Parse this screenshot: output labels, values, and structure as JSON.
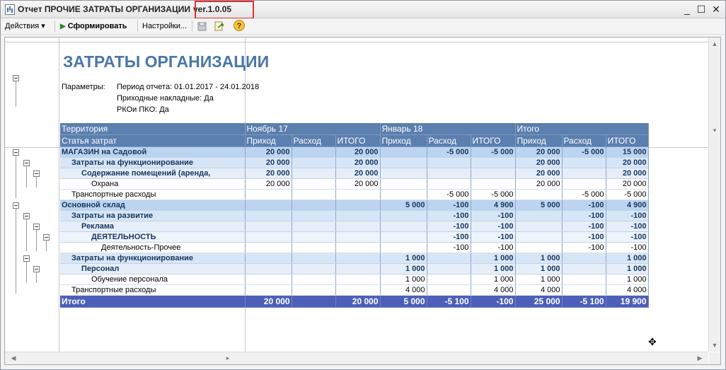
{
  "window": {
    "title_prefix": "Отчет  ПРОЧИЕ ЗАТРАТЫ ОРГАНИЗАЦИИ",
    "version": "ver.1.0.05",
    "minimize": "_",
    "maximize": "☐",
    "close": "✕"
  },
  "toolbar": {
    "actions_label": "Действия ▾",
    "generate_label": "Сформировать",
    "settings_label": "Настройки...",
    "help_label": "?"
  },
  "icons": {
    "app": "report-icon",
    "play": "play-icon",
    "save": "save-icon",
    "export": "export-icon",
    "help": "help-icon"
  },
  "colors": {
    "title": "#4a77a8",
    "header": "#5b7fae",
    "total": "#4d5fb8",
    "highlight": "#e03030"
  },
  "report": {
    "title": "ЗАТРАТЫ ОРГАНИЗАЦИИ",
    "params_label": "Параметры:",
    "params": [
      "Период отчета: 01.01.2017 - 24.01.2018",
      "Приходные накладные: Да",
      "РКОи ПКО: Да"
    ],
    "header_top": {
      "territory": "Территория",
      "nov": "Ноябрь 17",
      "jan": "Январь 18",
      "total": "Итого"
    },
    "header_bottom": {
      "article": "Статья затрат",
      "cols": [
        "Приход",
        "Расход",
        "ИТОГО",
        "Приход",
        "Расход",
        "ИТОГО",
        "Приход",
        "Расход",
        "ИТОГО"
      ]
    },
    "rows": [
      {
        "label": "МАГАЗИН на Садовой",
        "cls": "l0",
        "indent": 0,
        "v": [
          "20 000",
          "",
          "20 000",
          "",
          "-5 000",
          "-5 000",
          "20 000",
          "-5 000",
          "15 000"
        ]
      },
      {
        "label": "Затраты на функционирование",
        "cls": "l1",
        "indent": 1,
        "v": [
          "20 000",
          "",
          "20 000",
          "",
          "",
          "",
          "20 000",
          "",
          "20 000"
        ]
      },
      {
        "label": "Содержание помещений (аренда,",
        "cls": "l2",
        "indent": 2,
        "v": [
          "20 000",
          "",
          "20 000",
          "",
          "",
          "",
          "20 000",
          "",
          "20 000"
        ]
      },
      {
        "label": "Охрана",
        "cls": "leaf",
        "indent": 3,
        "v": [
          "20 000",
          "",
          "20 000",
          "",
          "",
          "",
          "20 000",
          "",
          "20 000"
        ]
      },
      {
        "label": "Транспортные расходы",
        "cls": "leaf",
        "indent": 1,
        "v": [
          "",
          "",
          "",
          "",
          "-5 000",
          "-5 000",
          "",
          "-5 000",
          "-5 000"
        ]
      },
      {
        "label": "Основной склад",
        "cls": "l0",
        "indent": 0,
        "v": [
          "",
          "",
          "",
          "5 000",
          "-100",
          "4 900",
          "5 000",
          "-100",
          "4 900"
        ]
      },
      {
        "label": "Затраты на развитие",
        "cls": "l1",
        "indent": 1,
        "v": [
          "",
          "",
          "",
          "",
          "-100",
          "-100",
          "",
          "-100",
          "-100"
        ]
      },
      {
        "label": "Реклама",
        "cls": "l2",
        "indent": 2,
        "v": [
          "",
          "",
          "",
          "",
          "-100",
          "-100",
          "",
          "-100",
          "-100"
        ]
      },
      {
        "label": "ДЕЯТЕЛЬНОСТЬ",
        "cls": "l3",
        "indent": 3,
        "v": [
          "",
          "",
          "",
          "",
          "-100",
          "-100",
          "",
          "-100",
          "-100"
        ]
      },
      {
        "label": "Деятельность-Прочее",
        "cls": "leaf",
        "indent": 4,
        "v": [
          "",
          "",
          "",
          "",
          "-100",
          "-100",
          "",
          "-100",
          "-100"
        ]
      },
      {
        "label": "Затраты на функционирование",
        "cls": "l1",
        "indent": 1,
        "v": [
          "",
          "",
          "",
          "1 000",
          "",
          "1 000",
          "1 000",
          "",
          "1 000"
        ]
      },
      {
        "label": "Персонал",
        "cls": "l2",
        "indent": 2,
        "v": [
          "",
          "",
          "",
          "1 000",
          "",
          "1 000",
          "1 000",
          "",
          "1 000"
        ]
      },
      {
        "label": "Обучение персонала",
        "cls": "leaf",
        "indent": 3,
        "v": [
          "",
          "",
          "",
          "1 000",
          "",
          "1 000",
          "1 000",
          "",
          "1 000"
        ]
      },
      {
        "label": "Транспортные расходы",
        "cls": "leaf",
        "indent": 1,
        "v": [
          "",
          "",
          "",
          "4 000",
          "",
          "4 000",
          "4 000",
          "",
          "4 000"
        ]
      }
    ],
    "total_row": {
      "label": "Итого",
      "v": [
        "20 000",
        "",
        "20 000",
        "5 000",
        "-5 100",
        "-100",
        "25 000",
        "-5 100",
        "19 900"
      ]
    }
  }
}
